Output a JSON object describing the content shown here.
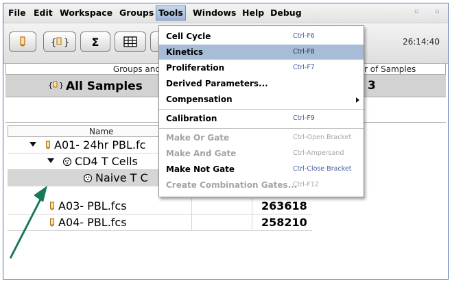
{
  "menubar": {
    "items": [
      "File",
      "Edit",
      "Workspace",
      "Groups",
      "Tools",
      "Windows",
      "Help",
      "Debug"
    ],
    "active": "Tools"
  },
  "toolbar": {
    "buttons": [
      "tube-icon",
      "group-icon",
      "sigma-icon",
      "table-icon",
      "layout-icon"
    ],
    "sigma_glyph": "Σ",
    "clock": "26:14:40"
  },
  "groups": {
    "header_left": "Groups and ",
    "header_right": "r of Samples",
    "all_samples": "All Samples",
    "count": "3"
  },
  "table": {
    "name_header": "Name",
    "rows": [
      {
        "label": "A01- 24hr PBL.fc",
        "count": ""
      },
      {
        "label": "CD4 T Cells",
        "count": ""
      },
      {
        "label": "Naive T C",
        "count": ""
      },
      {
        "label": "A03- PBL.fcs",
        "count": "263618"
      },
      {
        "label": "A04- PBL.fcs",
        "count": "258210"
      }
    ]
  },
  "tools_menu": {
    "items": [
      {
        "label": "Cell Cycle",
        "shortcut": "Ctrl-F6",
        "disabled": false
      },
      {
        "label": "Kinetics",
        "shortcut": "Ctrl-F8",
        "disabled": false,
        "highlighted": true
      },
      {
        "label": "Proliferation",
        "shortcut": "Ctrl-F7",
        "disabled": false
      },
      {
        "label": "Derived Parameters...",
        "shortcut": "",
        "disabled": false
      },
      {
        "label": "Compensation",
        "shortcut": "",
        "disabled": false,
        "submenu": true
      },
      {
        "label": "Calibration",
        "shortcut": "Ctrl-F9",
        "disabled": false
      },
      {
        "label": "Make Or Gate",
        "shortcut": "Ctrl-Open Bracket",
        "disabled": true
      },
      {
        "label": "Make And Gate",
        "shortcut": "Ctrl-Ampersand",
        "disabled": true
      },
      {
        "label": "Make Not Gate",
        "shortcut": "Ctrl-Close Bracket",
        "disabled": false
      },
      {
        "label": "Create Combination Gates...",
        "shortcut": "Ctrl-F12",
        "disabled": true
      }
    ]
  },
  "colors": {
    "accent": "#a7bcd6",
    "arrow": "#17785a",
    "shortcut": "#4560a0",
    "tube": "#d08a2a"
  }
}
